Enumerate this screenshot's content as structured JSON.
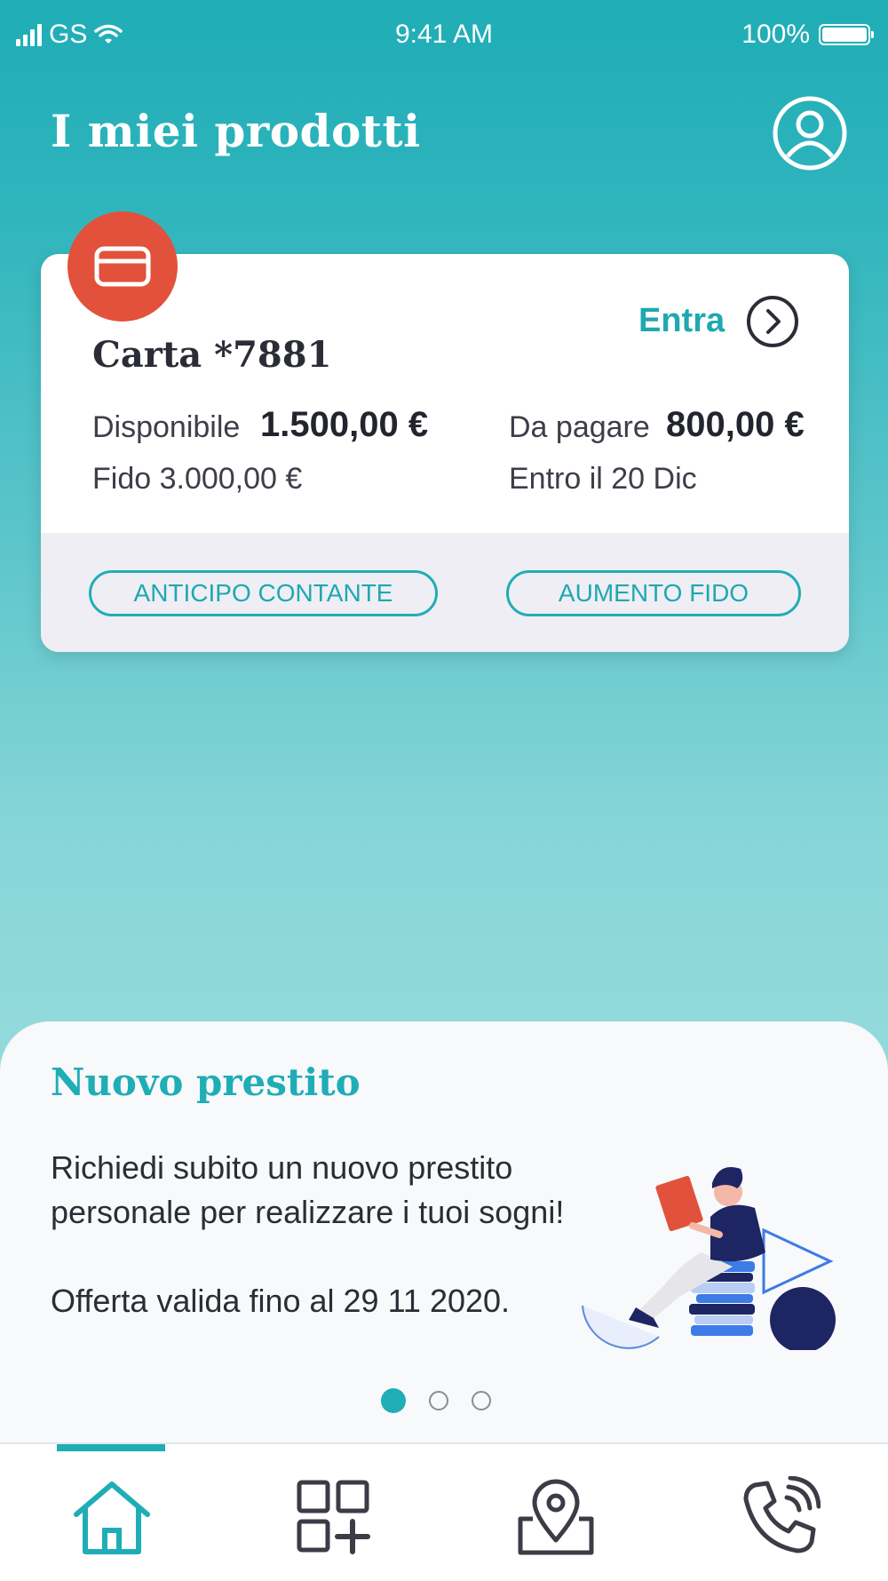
{
  "status_bar": {
    "carrier": "GS",
    "time": "9:41 AM",
    "battery": "100%"
  },
  "header": {
    "title": "I miei prodotti"
  },
  "card": {
    "name": "Carta *7881",
    "enter_label": "Entra",
    "available_label": "Disponibile",
    "available_value": "1.500,00 €",
    "credit_line": "Fido 3.000,00 €",
    "due_label": "Da pagare",
    "due_value": "800,00 €",
    "due_date": "Entro il 20 Dic",
    "button_cash_advance": "ANTICIPO CONTANTE",
    "button_increase_credit": "AUMENTO FIDO"
  },
  "promo": {
    "title": "Nuovo prestito",
    "text_line1": "Richiedi subito un nuovo prestito",
    "text_line2": "personale per realizzare i tuoi sogni!",
    "offer": "Offerta valida fino al 29 11 2020."
  },
  "pager": {
    "count": 3,
    "active_index": 0
  },
  "tabs": [
    {
      "icon": "home-icon"
    },
    {
      "icon": "products-add-icon"
    },
    {
      "icon": "map-pin-icon"
    },
    {
      "icon": "phone-icon"
    }
  ],
  "colors": {
    "accent": "#1fadb6",
    "card_badge": "#e2513b",
    "text_dark": "#2b2d36"
  }
}
